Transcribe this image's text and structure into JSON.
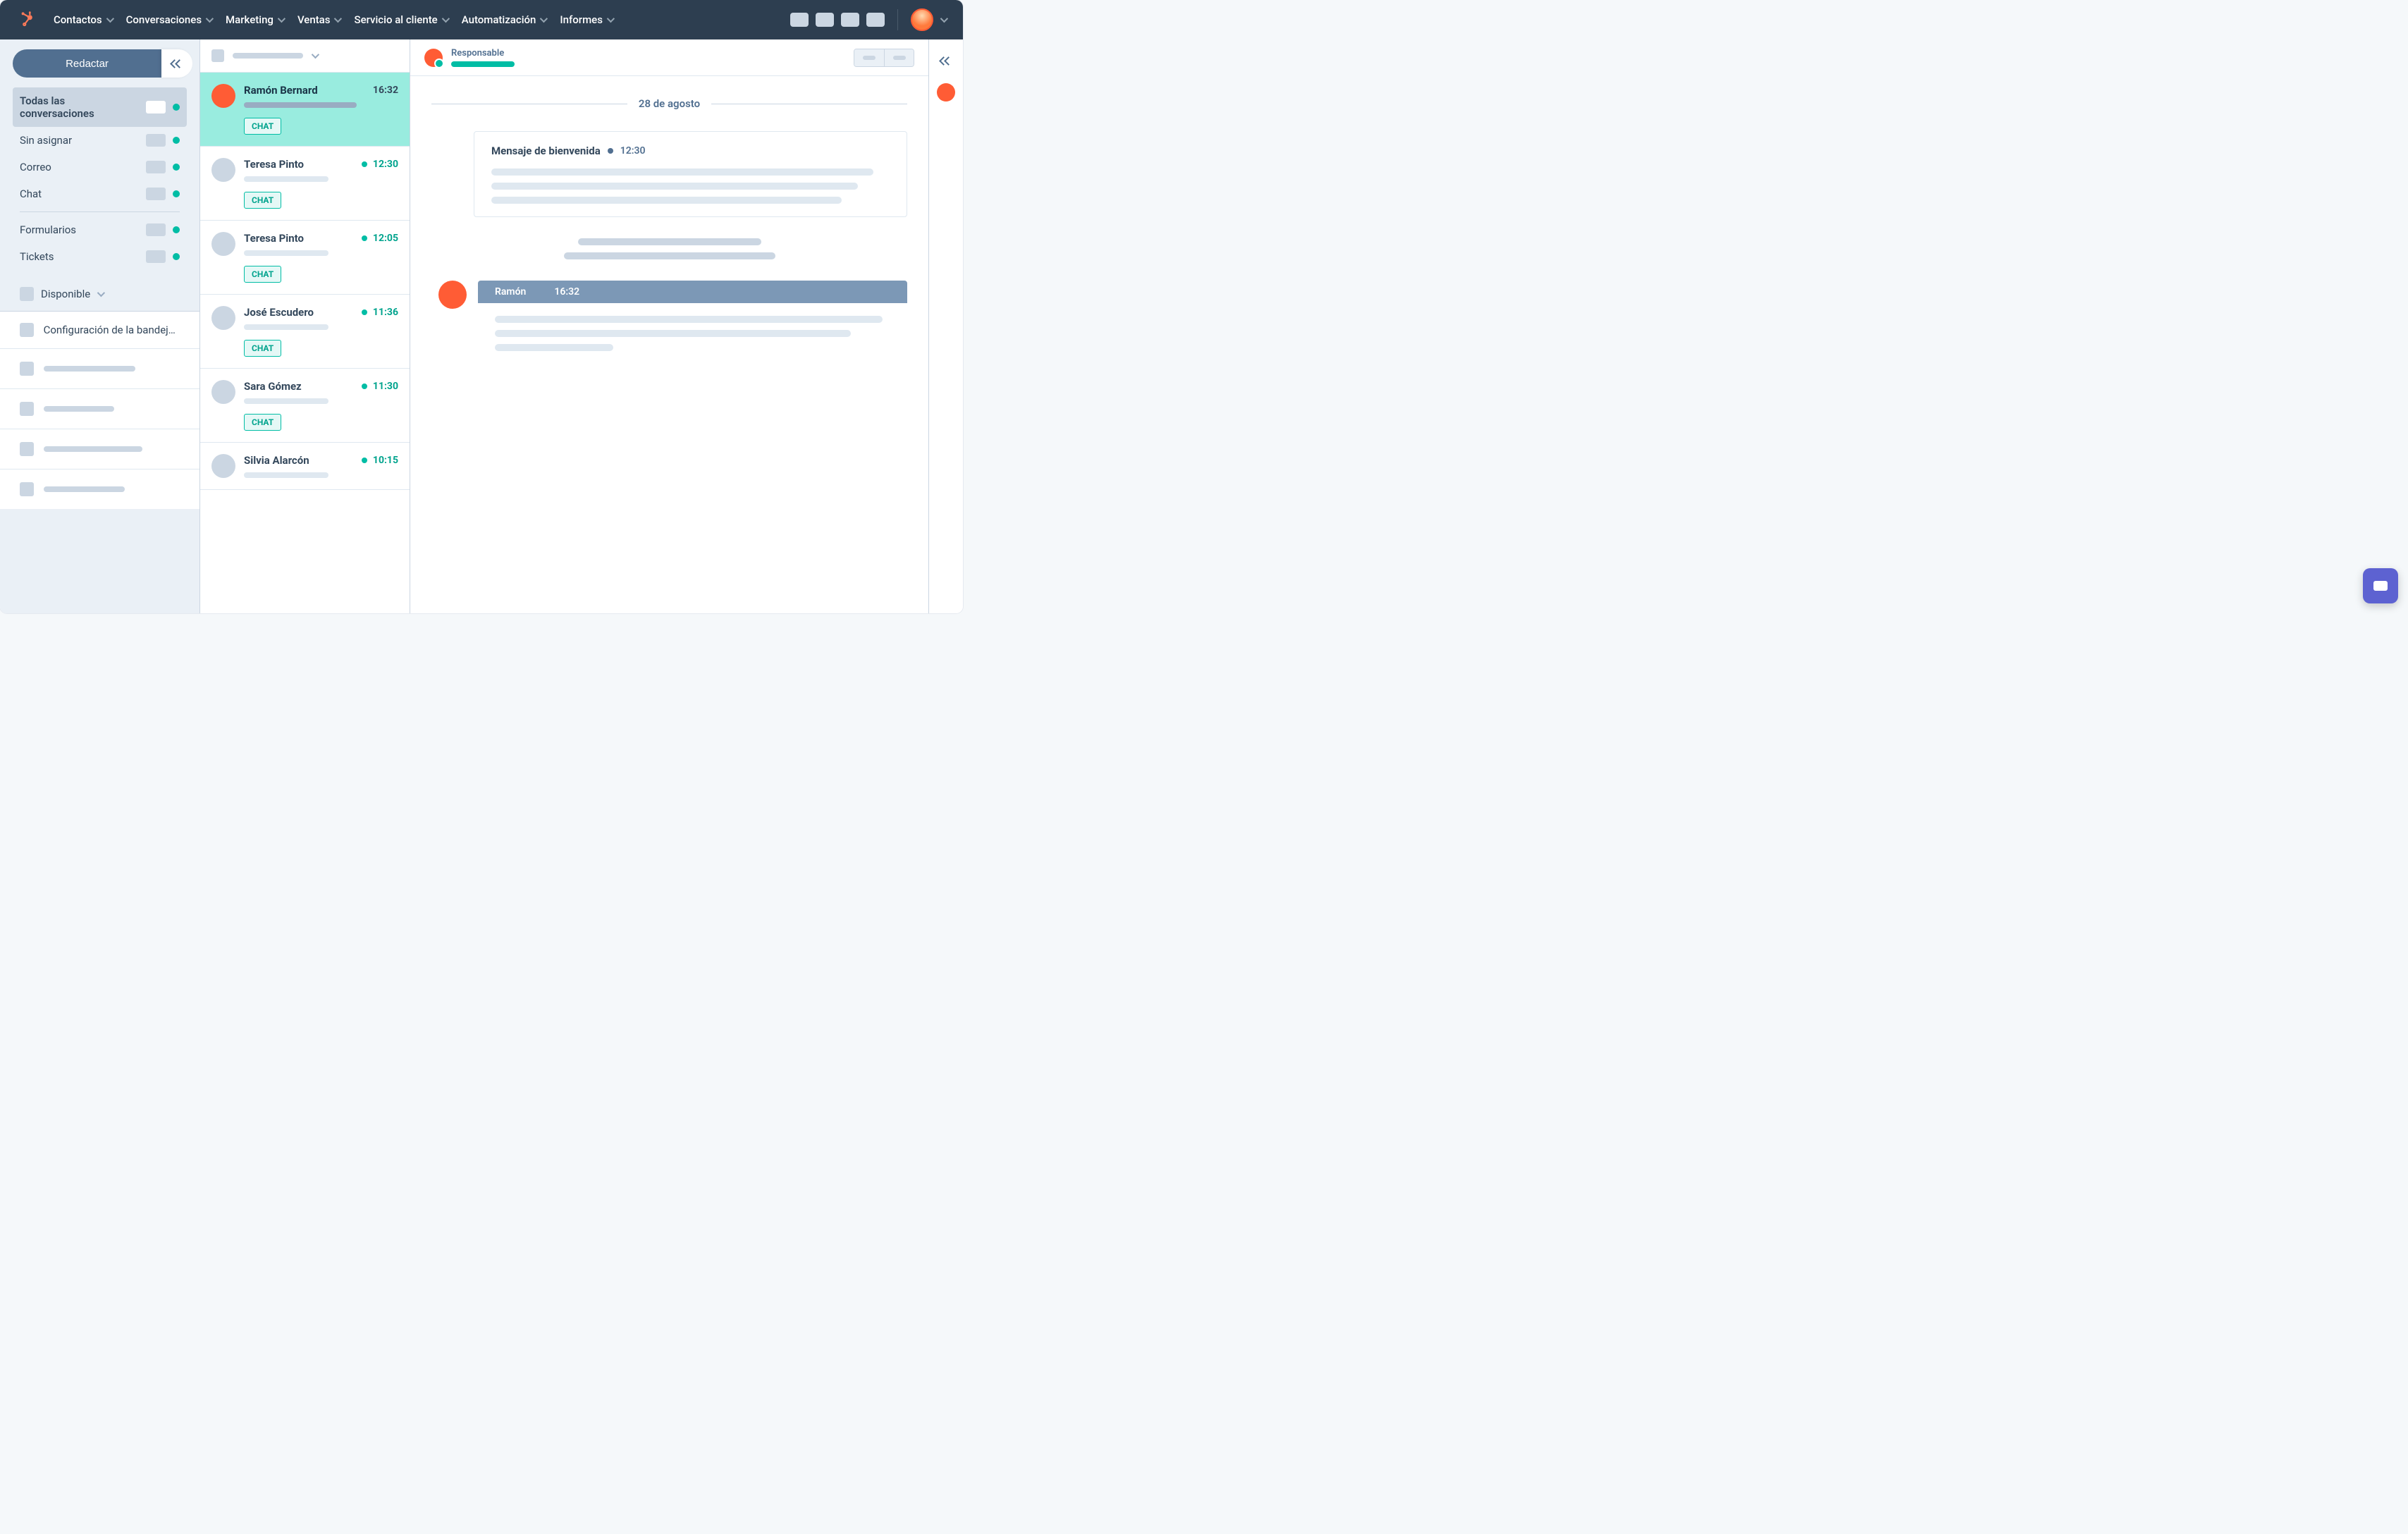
{
  "nav": {
    "items": [
      "Contactos",
      "Conversaciones",
      "Marketing",
      "Ventas",
      "Servicio al cliente",
      "Automatización",
      "Informes"
    ]
  },
  "sidebar": {
    "compose": "Redactar",
    "folders": [
      {
        "label": "Todas las conversaciones",
        "active": true
      },
      {
        "label": "Sin asignar"
      },
      {
        "label": "Correo"
      },
      {
        "label": "Chat"
      }
    ],
    "folders2": [
      {
        "label": "Formularios"
      },
      {
        "label": "Tickets"
      }
    ],
    "status": "Disponible",
    "config": "Configuración de la bandeja..."
  },
  "conversations": [
    {
      "name": "Ramón Bernard",
      "time": "16:32",
      "tag": "CHAT",
      "selected": true,
      "unread": false
    },
    {
      "name": "Teresa Pinto",
      "time": "12:30",
      "tag": "CHAT",
      "unread": true
    },
    {
      "name": "Teresa Pinto",
      "time": "12:05",
      "tag": "CHAT",
      "unread": true
    },
    {
      "name": "José Escudero",
      "time": "11:36",
      "tag": "CHAT",
      "unread": true
    },
    {
      "name": "Sara Gómez",
      "time": "11:30",
      "tag": "CHAT",
      "unread": true
    },
    {
      "name": "Silvia Alarcón",
      "time": "10:15",
      "tag": "",
      "unread": true
    }
  ],
  "thread": {
    "owner_label": "Responsable",
    "date": "28 de agosto",
    "welcome": {
      "title": "Mensaje de bienvenida",
      "time": "12:30"
    },
    "msg": {
      "from": "Ramón",
      "time": "16:32"
    }
  }
}
